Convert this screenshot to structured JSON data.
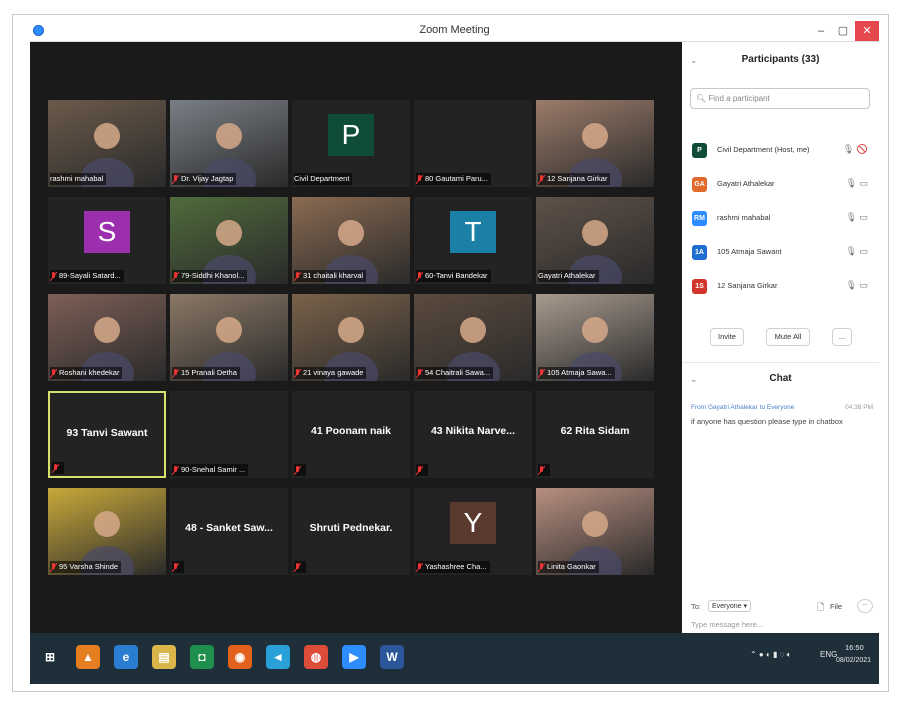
{
  "window": {
    "title": "Zoom Meeting",
    "minimize": "–",
    "restore": "▢",
    "close": "✕"
  },
  "gallery": [
    {
      "type": "video",
      "name": "rashmi mahabal",
      "muted": false,
      "bg": "#6b5a4a"
    },
    {
      "type": "video",
      "name": "Dr. Vijay Jagtap",
      "muted": true,
      "bg": "#7a7f86"
    },
    {
      "type": "letter",
      "letter": "P",
      "letter_bg": "#0f4d37",
      "name": "Civil Department",
      "muted": false
    },
    {
      "type": "blank",
      "name": "80 Gautami Paru...",
      "muted": true
    },
    {
      "type": "video",
      "name": "12 Sanjana Girkar",
      "muted": true,
      "bg": "#9b7b6a"
    },
    {
      "type": "letter",
      "letter": "S",
      "letter_bg": "#9b2fae",
      "name": "89-Sayali Satard...",
      "muted": true
    },
    {
      "type": "video",
      "name": "79-Siddhi Khanol...",
      "muted": true,
      "bg": "#4f6b3c"
    },
    {
      "type": "video",
      "name": "31 chaitali kharval",
      "muted": true,
      "bg": "#8a6b52"
    },
    {
      "type": "letter",
      "letter": "T",
      "letter_bg": "#1b7fa6",
      "name": "60-Tanvi Bandekar",
      "muted": true
    },
    {
      "type": "video",
      "name": "Gayatri Athalekar",
      "muted": false,
      "bg": "#5e5148"
    },
    {
      "type": "video",
      "name": "Roshani khedekar",
      "muted": true,
      "bg": "#7d5f56"
    },
    {
      "type": "video",
      "name": "15 Pranali Detha",
      "muted": true,
      "bg": "#8b7866"
    },
    {
      "type": "video",
      "name": "21 vinaya gawade",
      "muted": true,
      "bg": "#7a624a"
    },
    {
      "type": "video",
      "name": "54 Chaitrali Sawa...",
      "muted": true,
      "bg": "#5b4a3e"
    },
    {
      "type": "video",
      "name": "105 Atmaja Sawa...",
      "muted": true,
      "bg": "#a89a8e"
    },
    {
      "type": "name",
      "bigname": "93 Tanvi Sawant",
      "name": "",
      "muted": true,
      "active": true
    },
    {
      "type": "name",
      "bigname": "",
      "name": "90-Snehal Samir ...",
      "muted": true
    },
    {
      "type": "name",
      "bigname": "41 Poonam naik",
      "name": "",
      "muted": true
    },
    {
      "type": "name",
      "bigname": "43 Nikita Narve...",
      "name": "",
      "muted": true
    },
    {
      "type": "name",
      "bigname": "62 Rita Sidam",
      "name": "",
      "muted": true
    },
    {
      "type": "video",
      "name": "95 Varsha Shinde",
      "muted": true,
      "bg": "#c9a93a"
    },
    {
      "type": "name",
      "bigname": "48 - Sanket Saw...",
      "name": "",
      "muted": true
    },
    {
      "type": "name",
      "bigname": "Shruti Pednekar.",
      "name": "",
      "muted": true
    },
    {
      "type": "letter",
      "letter": "Y",
      "letter_bg": "#5a3a2e",
      "name": "Yashashree Cha...",
      "muted": true
    },
    {
      "type": "video",
      "name": "Linita Gaonkar",
      "muted": true,
      "bg": "#b78f80"
    }
  ],
  "participants": {
    "header": "Participants (33)",
    "search_placeholder": "Find a participant",
    "list": [
      {
        "initials": "P",
        "color": "#0f4d37",
        "name": "Civil Department (Host, me)",
        "icons": "🎙 🚫"
      },
      {
        "initials": "GA",
        "color": "#e06a2c",
        "name": "Gayatri Athalekar",
        "icons": "🎙 ▭"
      },
      {
        "initials": "RM",
        "color": "#2d8cff",
        "name": "rashmi mahabal",
        "icons": "🎙 ▭"
      },
      {
        "initials": "1A",
        "color": "#1f6fd1",
        "name": "105 Atmaja Sawant",
        "icons": "🎙 ▭"
      },
      {
        "initials": "1S",
        "color": "#d2352b",
        "name": "12 Sanjana Girkar",
        "icons": "🎙 ▭"
      }
    ],
    "invite": "Invite",
    "mute_all": "Mute All",
    "more": "..."
  },
  "chat": {
    "header": "Chat",
    "from": "From Gayatri Athalekar to Everyone",
    "time": "04:38 PM",
    "message": "if anyone has question please type in chatbox",
    "to_label": "To:",
    "to_value": "Everyone ▾",
    "file": "File",
    "more": "...",
    "placeholder": "Type message here..."
  },
  "taskbar": {
    "icons": [
      {
        "name": "windows-start-icon",
        "glyph": "⊞",
        "color": "#1e2f3a"
      },
      {
        "name": "vlc-icon",
        "glyph": "▲",
        "color": "#e67e22"
      },
      {
        "name": "internet-explorer-icon",
        "glyph": "e",
        "color": "#2a7dd1"
      },
      {
        "name": "file-explorer-icon",
        "glyph": "▤",
        "color": "#d9b54a"
      },
      {
        "name": "classroom-icon",
        "glyph": "◘",
        "color": "#1f8f4e"
      },
      {
        "name": "firefox-icon",
        "glyph": "◉",
        "color": "#e2611c"
      },
      {
        "name": "telegram-icon",
        "glyph": "◄",
        "color": "#2aa0d8"
      },
      {
        "name": "chrome-icon",
        "glyph": "◍",
        "color": "#dd4b39"
      },
      {
        "name": "zoom-icon",
        "glyph": "▶",
        "color": "#2d8cff"
      },
      {
        "name": "word-icon",
        "glyph": "W",
        "color": "#2b579a"
      }
    ],
    "lang": "ENG",
    "time": "16:50",
    "date": "08/02/2021"
  }
}
